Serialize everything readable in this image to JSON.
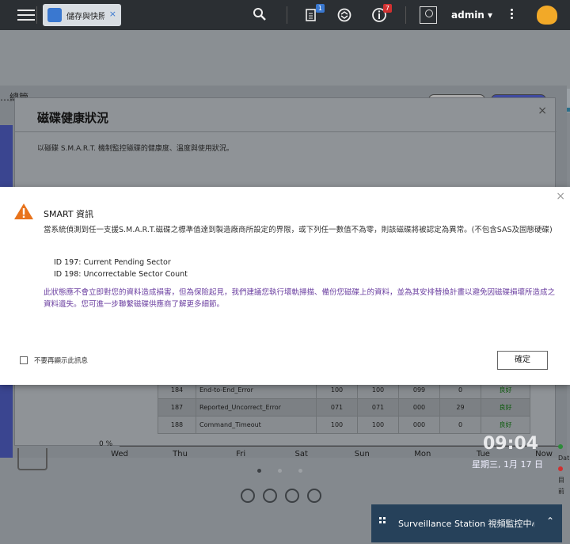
{
  "topbar": {
    "tab_label": "儲存與快照總管",
    "tab_close": "×",
    "backup_badge": "1",
    "notification_badge": "7",
    "user_name": "admin ▾"
  },
  "storage_window": {
    "title": "…總管"
  },
  "disk_health": {
    "title": "磁碟健康狀況",
    "close": "×",
    "description": "以磁碟 S.M.A.R.T. 機制監控磁碟的健康度、溫度與使用狀況。",
    "smart_rows": [
      {
        "id": "184",
        "attribute": "End-to-End_Error",
        "current": "100",
        "worst": "100",
        "threshold": "099",
        "raw": "0",
        "status": "良好"
      },
      {
        "id": "187",
        "attribute": "Reported_Uncorrect_Error",
        "current": "071",
        "worst": "071",
        "threshold": "000",
        "raw": "29",
        "status": "良好"
      },
      {
        "id": "188",
        "attribute": "Command_Timeout",
        "current": "100",
        "worst": "100",
        "threshold": "000",
        "raw": "0",
        "status": "良好"
      }
    ]
  },
  "chart_data": {
    "type": "line",
    "x": [
      "Wed",
      "Thu",
      "Fri",
      "Sat",
      "Sun",
      "Mon",
      "Tue",
      "Now"
    ],
    "ytick": "0 %",
    "legend": [
      "Dat",
      "目前"
    ],
    "colors": [
      "#2e8b3a",
      "#d03030"
    ]
  },
  "clock": {
    "time": "09:04",
    "date": "星期三, 1月 17 日"
  },
  "notification": {
    "text": "Surveillance Station 視頻監控中心",
    "chevron": "⌃"
  },
  "dialog": {
    "title": "SMART 資訊",
    "body": "當系統偵測到任一支援S.M.A.R.T.磁碟之標準值達到製造廠商所設定的界限，或下列任一數值不為零，則該磁碟將被認定為異常。(不包含SAS及固態硬碟)",
    "id1": "ID 197: Current Pending Sector",
    "id2": "ID 198: Uncorrectable Sector Count",
    "note": "此狀態應不會立即對您的資料造成損害，但為保險起見，我們建議您執行壞軌掃描、備份您磁碟上的資料，並為其安排替換計畫以避免因磁碟損壞所造成之資料遺失。您可進一步聯繫磁碟供應商了解更多細節。",
    "checkbox_label": "不要再顯示此訊息",
    "ok_label": "確定",
    "close": "×",
    "warning_color": "#e8731c"
  }
}
